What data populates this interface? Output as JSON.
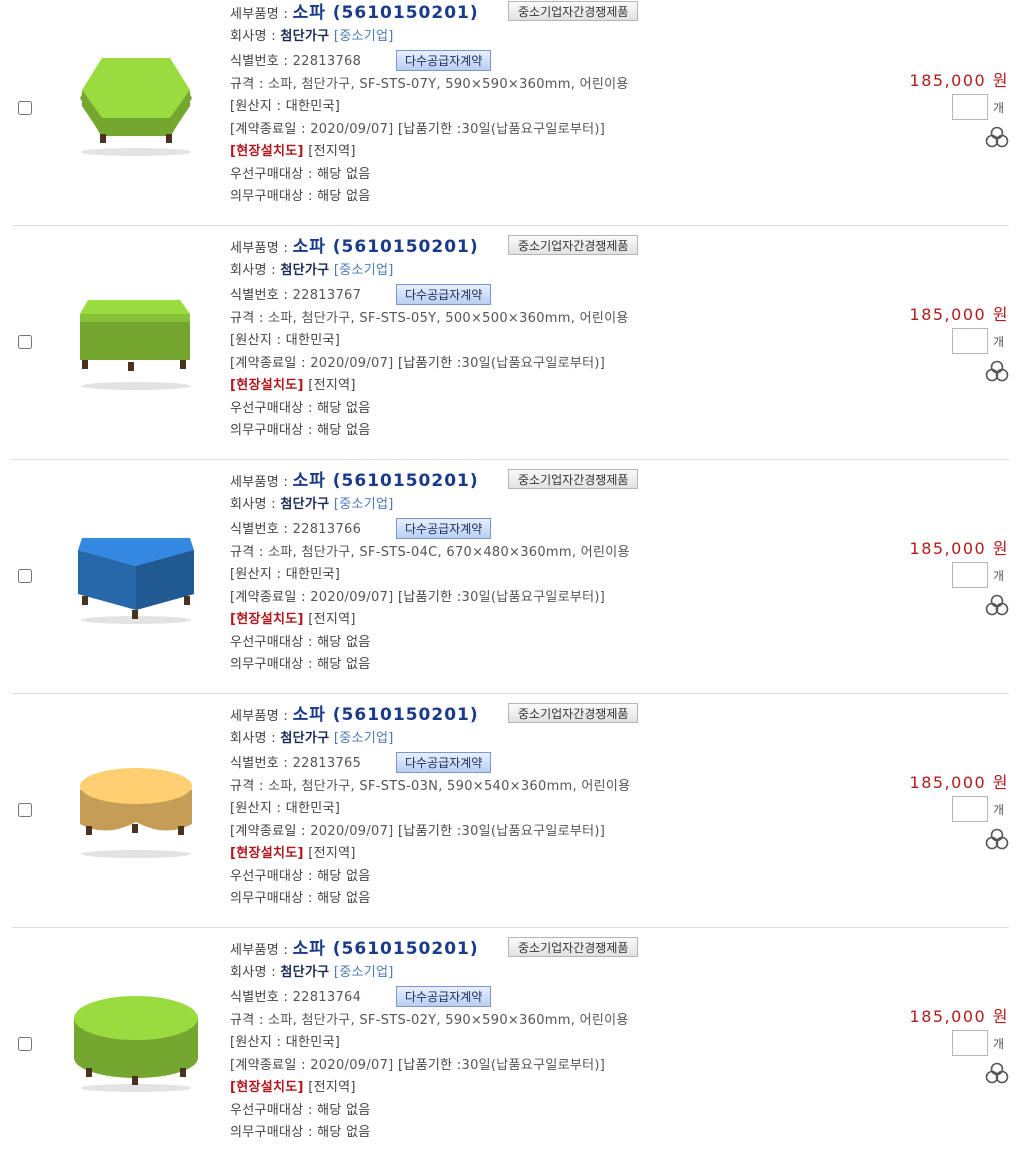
{
  "items": [
    {
      "label_item": "세부품명 :",
      "name": "소파 (5610150201)",
      "badge_sme": "중소기업자간경쟁제품",
      "label_company": "회사명 :",
      "company": "첨단가구",
      "company_tag": "[중소기업]",
      "label_id": "식별번호 :",
      "id": "22813768",
      "badge_contract": "다수공급자계약",
      "spec_label": "규격 :",
      "spec": "소파, 첨단가구, SF-STS-07Y, 590×590×360mm, 어린이용",
      "origin": "[원산지 : 대한민국]",
      "contract_end_label": "[계약종료일 :",
      "contract_end": "2020/09/07]",
      "delivery_label": "[납품기한 :",
      "delivery": "30일(납품요구일로부터)]",
      "install_tag": "[현장설치도]",
      "region": "[전지역]",
      "priority": "우선구매대상 : 해당 없음",
      "mandatory": "의무구매대상 : 해당 없음",
      "price": "185,000 원",
      "unit": "개",
      "color": "#8fcc3a",
      "shape": "hexagon",
      "image_name": "green-hexagon-stool-image"
    },
    {
      "label_item": "세부품명 :",
      "name": "소파 (5610150201)",
      "badge_sme": "중소기업자간경쟁제품",
      "label_company": "회사명 :",
      "company": "첨단가구",
      "company_tag": "[중소기업]",
      "label_id": "식별번호 :",
      "id": "22813767",
      "badge_contract": "다수공급자계약",
      "spec_label": "규격 :",
      "spec": "소파, 첨단가구, SF-STS-05Y, 500×500×360mm, 어린이용",
      "origin": "[원산지 : 대한민국]",
      "contract_end_label": "[계약종료일 :",
      "contract_end": "2020/09/07]",
      "delivery_label": "[납품기한 :",
      "delivery": "30일(납품요구일로부터)]",
      "install_tag": "[현장설치도]",
      "region": "[전지역]",
      "priority": "우선구매대상 : 해당 없음",
      "mandatory": "의무구매대상 : 해당 없음",
      "price": "185,000 원",
      "unit": "개",
      "color": "#8fcc3a",
      "shape": "square",
      "image_name": "green-square-stool-image"
    },
    {
      "label_item": "세부품명 :",
      "name": "소파 (5610150201)",
      "badge_sme": "중소기업자간경쟁제품",
      "label_company": "회사명 :",
      "company": "첨단가구",
      "company_tag": "[중소기업]",
      "label_id": "식별번호 :",
      "id": "22813766",
      "badge_contract": "다수공급자계약",
      "spec_label": "규격 :",
      "spec": "소파, 첨단가구, SF-STS-04C, 670×480×360mm, 어린이용",
      "origin": "[원산지 : 대한민국]",
      "contract_end_label": "[계약종료일 :",
      "contract_end": "2020/09/07]",
      "delivery_label": "[납품기한 :",
      "delivery": "30일(납품요구일로부터)]",
      "install_tag": "[현장설치도]",
      "region": "[전지역]",
      "priority": "우선구매대상 : 해당 없음",
      "mandatory": "의무구매대상 : 해당 없음",
      "price": "185,000 원",
      "unit": "개",
      "color": "#2f7fd0",
      "shape": "trapezoid",
      "image_name": "blue-trapezoid-stool-image"
    },
    {
      "label_item": "세부품명 :",
      "name": "소파 (5610150201)",
      "badge_sme": "중소기업자간경쟁제품",
      "label_company": "회사명 :",
      "company": "첨단가구",
      "company_tag": "[중소기업]",
      "label_id": "식별번호 :",
      "id": "22813765",
      "badge_contract": "다수공급자계약",
      "spec_label": "규격 :",
      "spec": "소파, 첨단가구, SF-STS-03N, 590×540×360mm, 어린이용",
      "origin": "[원산지 : 대한민국]",
      "contract_end_label": "[계약종료일 :",
      "contract_end": "2020/09/07]",
      "delivery_label": "[납품기한 :",
      "delivery": "30일(납품요구일로부터)]",
      "install_tag": "[현장설치도]",
      "region": "[전지역]",
      "priority": "우선구매대상 : 해당 없음",
      "mandatory": "의무구매대상 : 해당 없음",
      "price": "185,000 원",
      "unit": "개",
      "color": "#f2c06a",
      "shape": "arc",
      "image_name": "yellow-curved-stool-image"
    },
    {
      "label_item": "세부품명 :",
      "name": "소파 (5610150201)",
      "badge_sme": "중소기업자간경쟁제품",
      "label_company": "회사명 :",
      "company": "첨단가구",
      "company_tag": "[중소기업]",
      "label_id": "식별번호 :",
      "id": "22813764",
      "badge_contract": "다수공급자계약",
      "spec_label": "규격 :",
      "spec": "소파, 첨단가구, SF-STS-02Y, 590×590×360mm, 어린이용",
      "origin": "[원산지 : 대한민국]",
      "contract_end_label": "[계약종료일 :",
      "contract_end": "2020/09/07]",
      "delivery_label": "[납품기한 :",
      "delivery": "30일(납품요구일로부터)]",
      "install_tag": "[현장설치도]",
      "region": "[전지역]",
      "priority": "우선구매대상 : 해당 없음",
      "mandatory": "의무구매대상 : 해당 없음",
      "price": "185,000 원",
      "unit": "개",
      "color": "#8fcc3a",
      "shape": "round",
      "image_name": "green-round-stool-image"
    }
  ]
}
